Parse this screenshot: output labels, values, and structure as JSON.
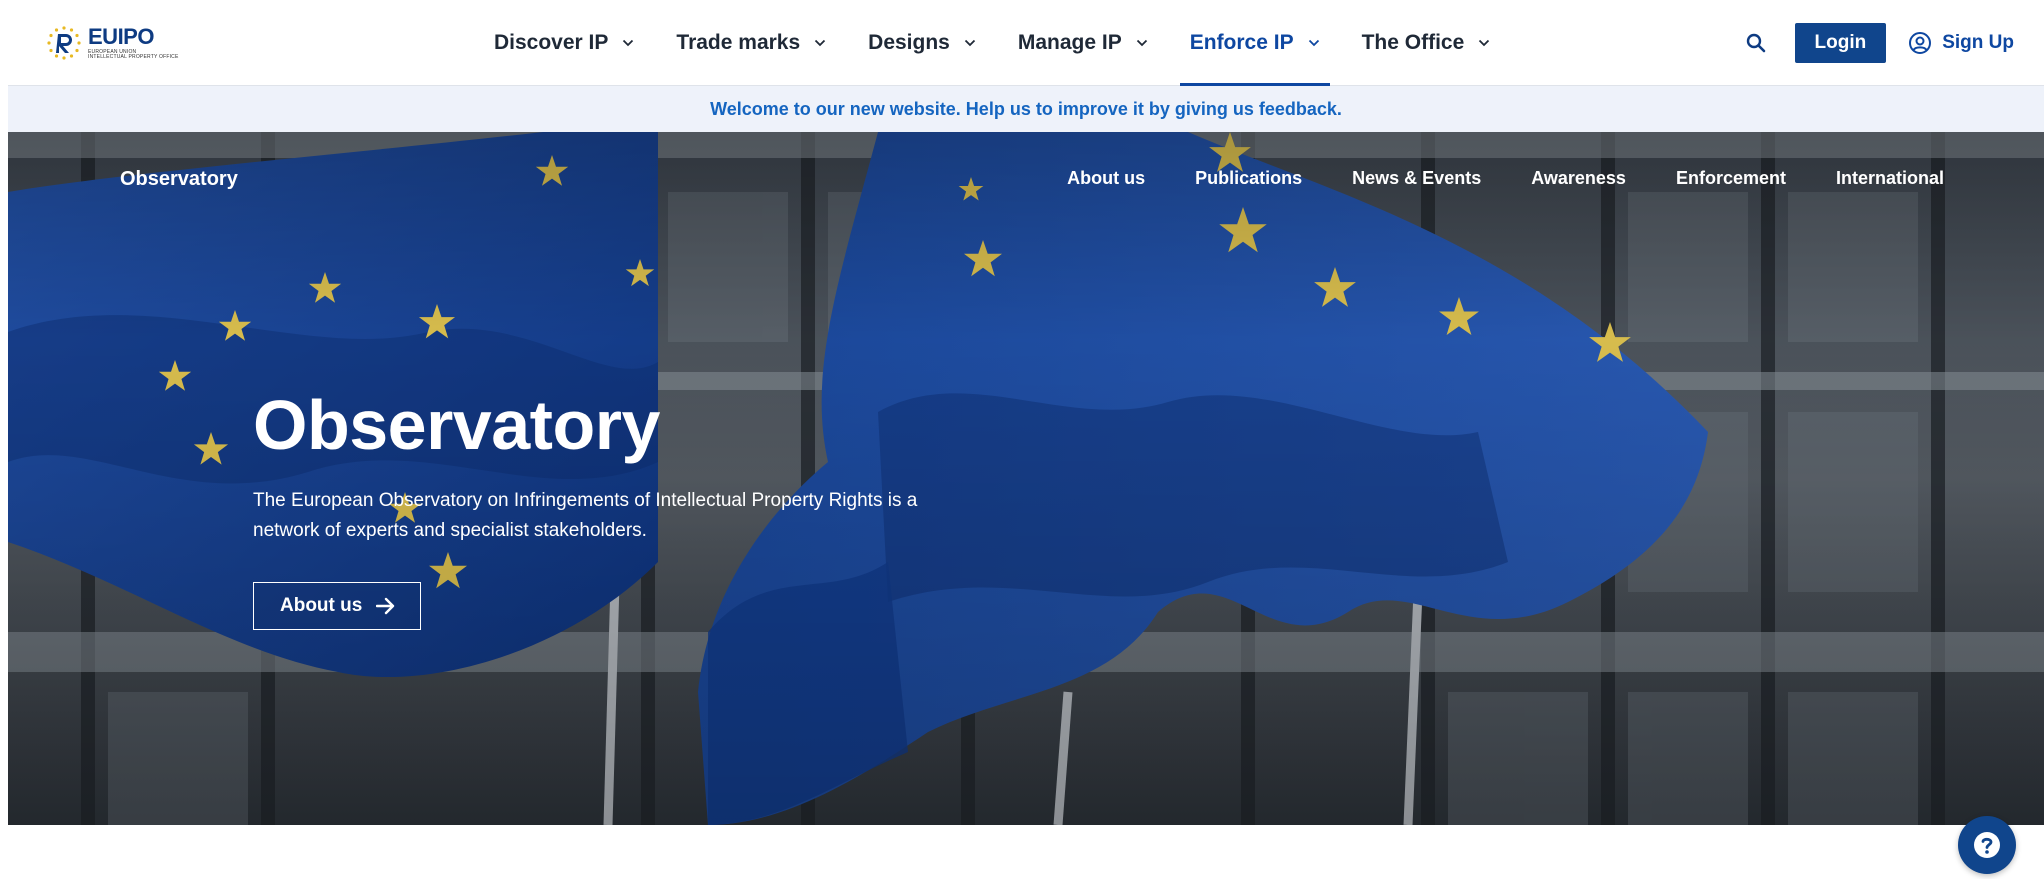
{
  "logo": {
    "name_eu": "EU",
    "name_ipo": "IPO",
    "subtitle_line1": "EUROPEAN UNION",
    "subtitle_line2": "INTELLECTUAL PROPERTY OFFICE"
  },
  "mainnav": {
    "items": [
      {
        "label": "Discover IP",
        "active": false
      },
      {
        "label": "Trade marks",
        "active": false
      },
      {
        "label": "Designs",
        "active": false
      },
      {
        "label": "Manage IP",
        "active": false
      },
      {
        "label": "Enforce IP",
        "active": true
      },
      {
        "label": "The Office",
        "active": false
      }
    ]
  },
  "header": {
    "search_icon": "search-icon",
    "login_label": "Login",
    "signup_label": "Sign Up",
    "signup_icon": "user-circle-icon"
  },
  "banner": {
    "text": "Welcome to our new website. Help us to improve it by giving us feedback."
  },
  "subnav": {
    "title": "Observatory",
    "links": [
      "About us",
      "Publications",
      "News & Events",
      "Awareness",
      "Enforcement",
      "International"
    ]
  },
  "hero": {
    "title": "Observatory",
    "description": "The European Observatory on Infringements of Intellectual Property Rights is a network of experts and specialist stakeholders.",
    "button_label": "About us",
    "button_icon": "arrow-right-icon"
  },
  "help": {
    "icon": "help-question-icon"
  },
  "colors": {
    "brand_blue": "#10458c",
    "link_blue": "#1565c0",
    "banner_bg": "#eef2fa",
    "flag_blue": "#1d4aa3",
    "star_gold": "#e8c84a"
  }
}
